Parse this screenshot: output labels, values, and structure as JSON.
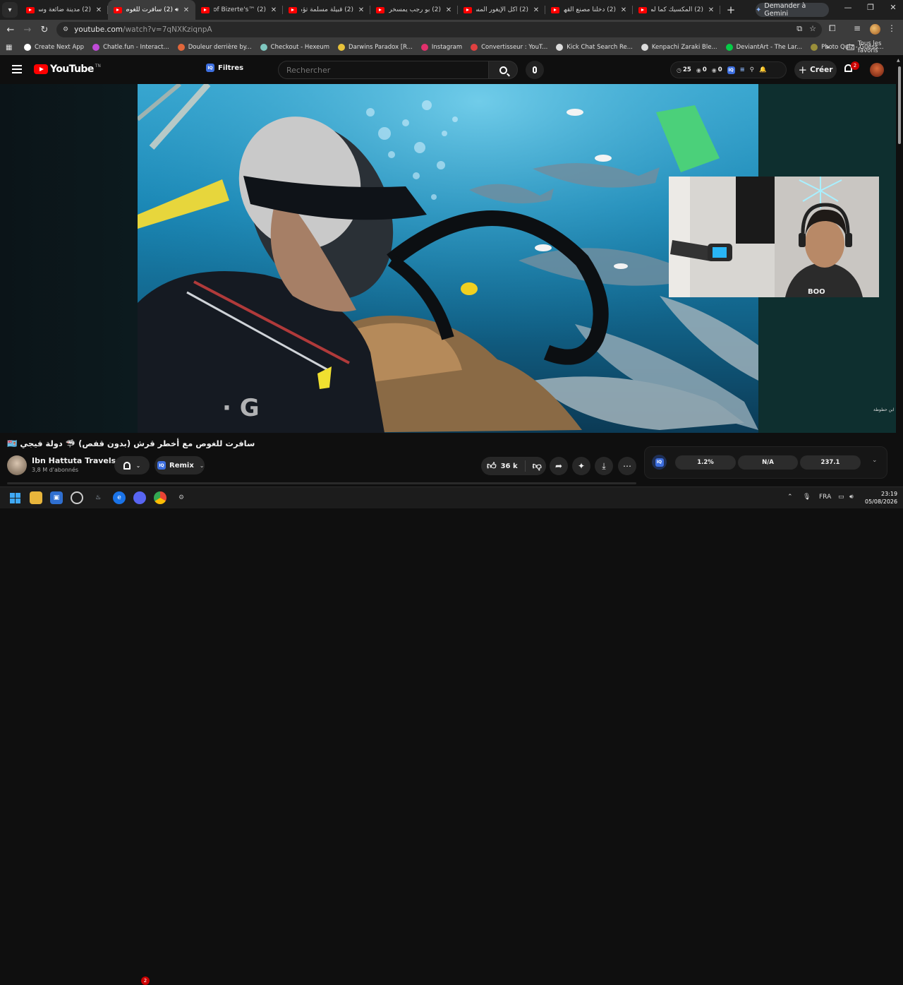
{
  "browser": {
    "tabs": [
      {
        "title": "(2) مدينة ضائعة وسط",
        "active": false
      },
      {
        "title": "(2) سافرت للغوص",
        "active": true
      },
      {
        "title": "(2) ™One of Bizerte's",
        "active": false
      },
      {
        "title": "(2) قبيلة مسلمة تؤمن",
        "active": false
      },
      {
        "title": "(2) بو رجب يمسخر الد",
        "active": false
      },
      {
        "title": "(2) أكل الإيغور المسلم",
        "active": false
      },
      {
        "title": "(2) دخلنا مصنع القهوة",
        "active": false
      },
      {
        "title": "(2) المكسيك كما لم تر",
        "active": false
      }
    ],
    "gemini_label": "Demander à Gemini",
    "url_host": "youtube.com",
    "url_path": "/watch?v=7qNXKziqnpA",
    "bookmarks": [
      {
        "label": "Create Next App",
        "color": "#ffffff"
      },
      {
        "label": "Chatle.fun - Interact...",
        "color": "#c04bd8"
      },
      {
        "label": "Douleur derrière by...",
        "color": "#e0663a"
      },
      {
        "label": "Checkout - Hexeum",
        "color": "#7fc7c0"
      },
      {
        "label": "Darwins Paradox [R...",
        "color": "#e8c23a"
      },
      {
        "label": "Instagram",
        "color": "#e1306c"
      },
      {
        "label": "Convertisseur : YouT...",
        "color": "#e04040"
      },
      {
        "label": "Kick Chat Search Re...",
        "color": "#dddddd"
      },
      {
        "label": "Kenpachi Zaraki Ble...",
        "color": "#dddddd"
      },
      {
        "label": "DeviantArt - The Lar...",
        "color": "#05cc47"
      },
      {
        "label": "Photo Quiz - Guess...",
        "color": "#9a8f3a"
      }
    ],
    "all_bookmarks_label": "Tous les favoris"
  },
  "youtube": {
    "logo_text": "YouTube",
    "region_code": "TN",
    "filters_label": "Filtres",
    "search_placeholder": "Rechercher",
    "header_stats": {
      "clock_count": "25",
      "eye_count_1": "0",
      "eye_count_2": "0"
    },
    "create_label": "Créer",
    "notification_count": "2",
    "video": {
      "title": "سافرت للغوص مع أخطر قرش (بدون قفص) 🦈 دولة فيجي 🇫🇯",
      "channel": "Ibn Hattuta Travels",
      "subscribers": "3,8 M d'abonnés",
      "remix_label": "Remix",
      "likes": "36 k",
      "watermark": "ابن حطوطة"
    },
    "metrics": [
      "1.2%",
      "N/A",
      "237.1"
    ]
  },
  "taskbar": {
    "language": "FRA",
    "time": "23:19",
    "date": "05/08/2026",
    "messenger_badge": "2"
  },
  "colors": {
    "brand_red": "#ff0000",
    "iq_blue": "#3d6fe0",
    "bg": "#0f0f0f"
  }
}
